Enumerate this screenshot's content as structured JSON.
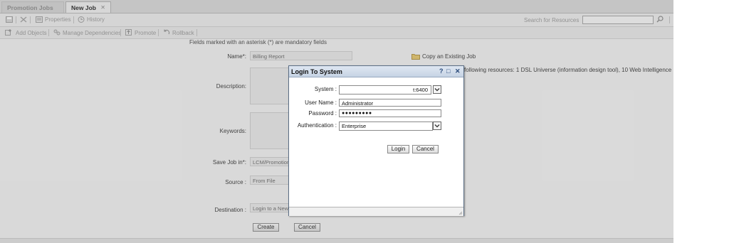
{
  "tabs": [
    {
      "label": "Promotion Jobs",
      "active": false
    },
    {
      "label": "New Job",
      "active": true,
      "close": "✕"
    }
  ],
  "toolbar1": {
    "properties_label": "Properties",
    "history_label": "History",
    "search_label": "Search for Resources",
    "search_value": ""
  },
  "toolbar2": {
    "add_objects_label": "Add Objects",
    "manage_dependencies_label": "Manage Dependencies",
    "promote_label": "Promote",
    "rollback_label": "Rollback"
  },
  "form": {
    "note": "Fields marked with an asterisk (*) are mandatory fields",
    "name_label": "Name*:",
    "name_value": "Billing Report",
    "description_label": "Description:",
    "keywords_label": "Keywords:",
    "save_job_label": "Save Job in*:",
    "save_job_value": "LCM/Promotion",
    "source_label": "Source :",
    "source_value": "From File",
    "destination_label": "Destination :",
    "destination_value": "Login to a New",
    "copy_link": "Copy an Existing Job",
    "resources_text": "following resources: 1 DSL Universe (information design tool), 10 Web Intelligence",
    "create_label": "Create",
    "cancel_label": "Cancel"
  },
  "dialog": {
    "title": "Login To System",
    "help": "?",
    "maximize": "□",
    "close": "✕",
    "system_label": "System :",
    "system_value": "t:6400",
    "username_label": "User Name :",
    "username_value": "Administrator",
    "password_label": "Password :",
    "password_value": "●●●●●●●●●",
    "auth_label": "Authentication :",
    "auth_value": "Enterprise",
    "login_label": "Login",
    "cancel_label": "Cancel"
  },
  "colors": {
    "dialog_title_bg": "#c6d3e4",
    "dialog_border": "#5c6f86",
    "app_bg": "#eeeeee"
  }
}
